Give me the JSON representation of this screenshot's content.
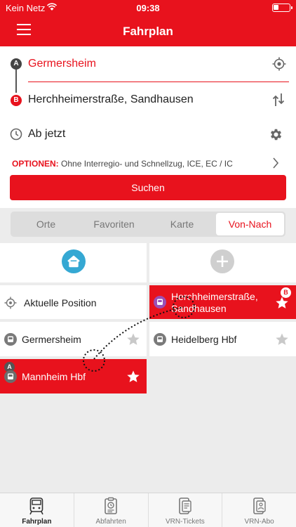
{
  "status": {
    "carrier": "Kein Netz",
    "time": "09:38"
  },
  "header": {
    "title": "Fahrplan"
  },
  "form": {
    "origin": "Germersheim",
    "destination": "Herchheimerstraße, Sandhausen",
    "time": "Ab jetzt",
    "options_label": "OPTIONEN:",
    "options_value": "Ohne Interregio- und Schnellzug, ICE, EC / IC",
    "search_label": "Suchen",
    "pin_a": "A",
    "pin_b": "B"
  },
  "tabs": [
    {
      "label": "Orte"
    },
    {
      "label": "Favoriten"
    },
    {
      "label": "Karte"
    },
    {
      "label": "Von-Nach",
      "active": true
    }
  ],
  "places": {
    "current": "Aktuelle Position",
    "dest": "Herchheimerstraße, Sandhausen",
    "dest_badge": "B",
    "germersheim": "Germersheim",
    "heidelberg": "Heidelberg Hbf",
    "mannheim": "Mannheim Hbf",
    "mannheim_badge": "A"
  },
  "bottomnav": [
    {
      "label": "Fahrplan",
      "icon": "train-icon",
      "active": true
    },
    {
      "label": "Abfahrten",
      "icon": "departures-icon"
    },
    {
      "label": "VRN-Tickets",
      "icon": "tickets-icon"
    },
    {
      "label": "VRN-Abo",
      "icon": "subscription-icon"
    }
  ],
  "colors": {
    "brand": "#e8121d",
    "home": "#35a8d3",
    "tram_icon": "#9b4fb5"
  }
}
